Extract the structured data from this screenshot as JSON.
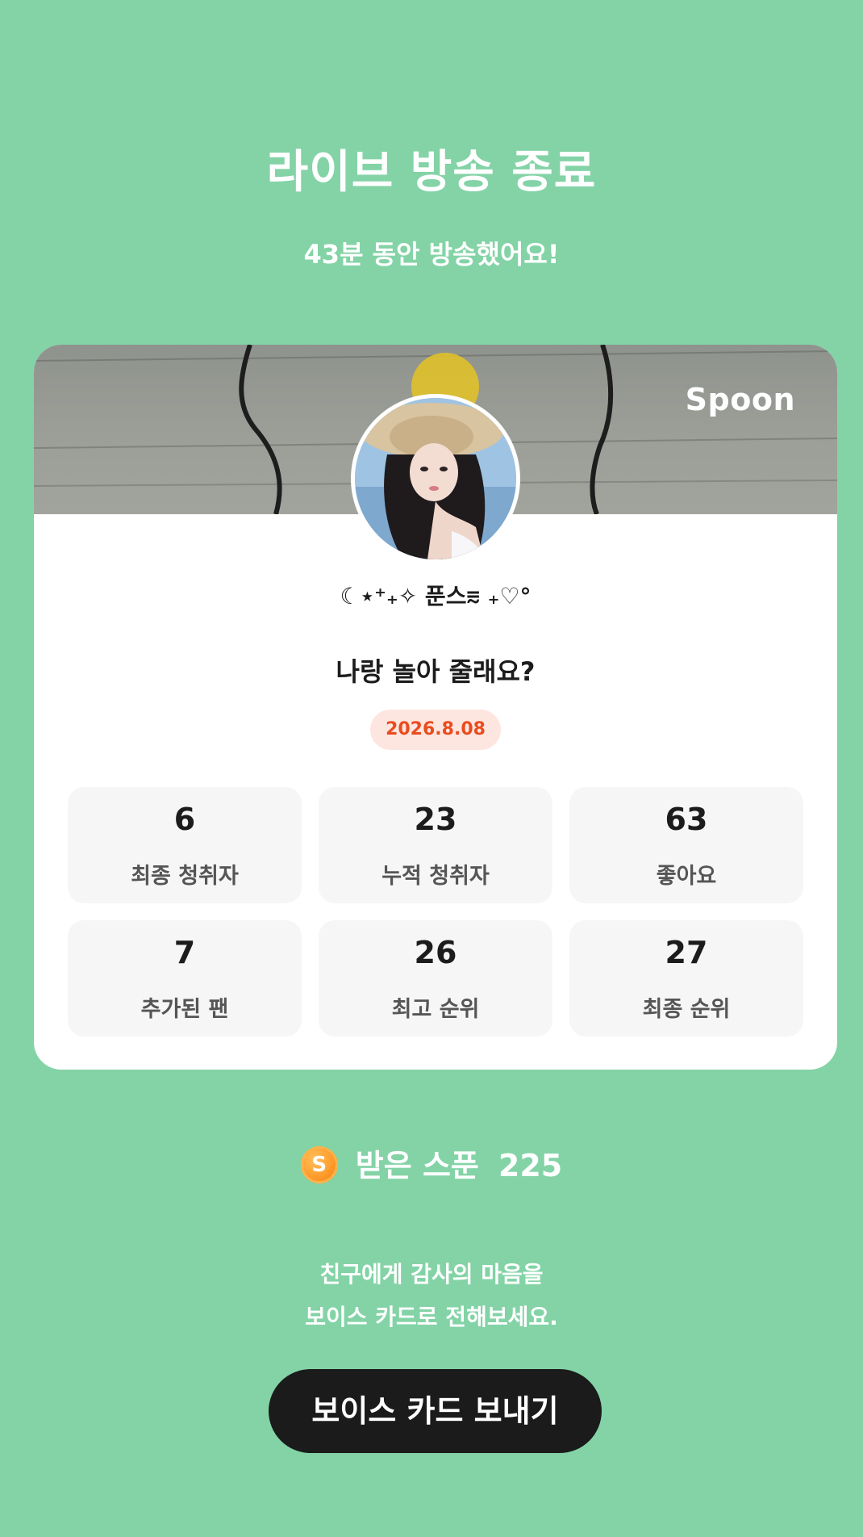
{
  "header": {
    "title": "라이브 방송 종료",
    "subtitle": "43분 동안 방송했어요!"
  },
  "card": {
    "brand": "Spoon",
    "nickname": "☾⋆⁺₊✧ 푼스⩳ ₊♡°",
    "live_title": "나랑 놀아 줄래요?",
    "date": "2026.8.08",
    "stats": [
      {
        "value": "6",
        "label": "최종 청취자"
      },
      {
        "value": "23",
        "label": "누적 청취자"
      },
      {
        "value": "63",
        "label": "좋아요"
      },
      {
        "value": "7",
        "label": "추가된 팬"
      },
      {
        "value": "26",
        "label": "최고 순위"
      },
      {
        "value": "27",
        "label": "최종 순위"
      }
    ]
  },
  "spoons": {
    "coin_letter": "S",
    "label": "받은 스푼",
    "count": "225"
  },
  "message": {
    "line1": "친구에게 감사의 마음을",
    "line2": "보이스 카드로 전해보세요."
  },
  "button": {
    "label": "보이스 카드 보내기"
  },
  "colors": {
    "background": "#83d3a6",
    "date_badge_bg": "#fde6df",
    "date_badge_text": "#ea4c1f",
    "button_bg": "#1b1b1b"
  },
  "icons": {
    "brand_logo": "spoon-logo",
    "coin": "spoon-coin-icon",
    "avatar": "profile-avatar"
  }
}
